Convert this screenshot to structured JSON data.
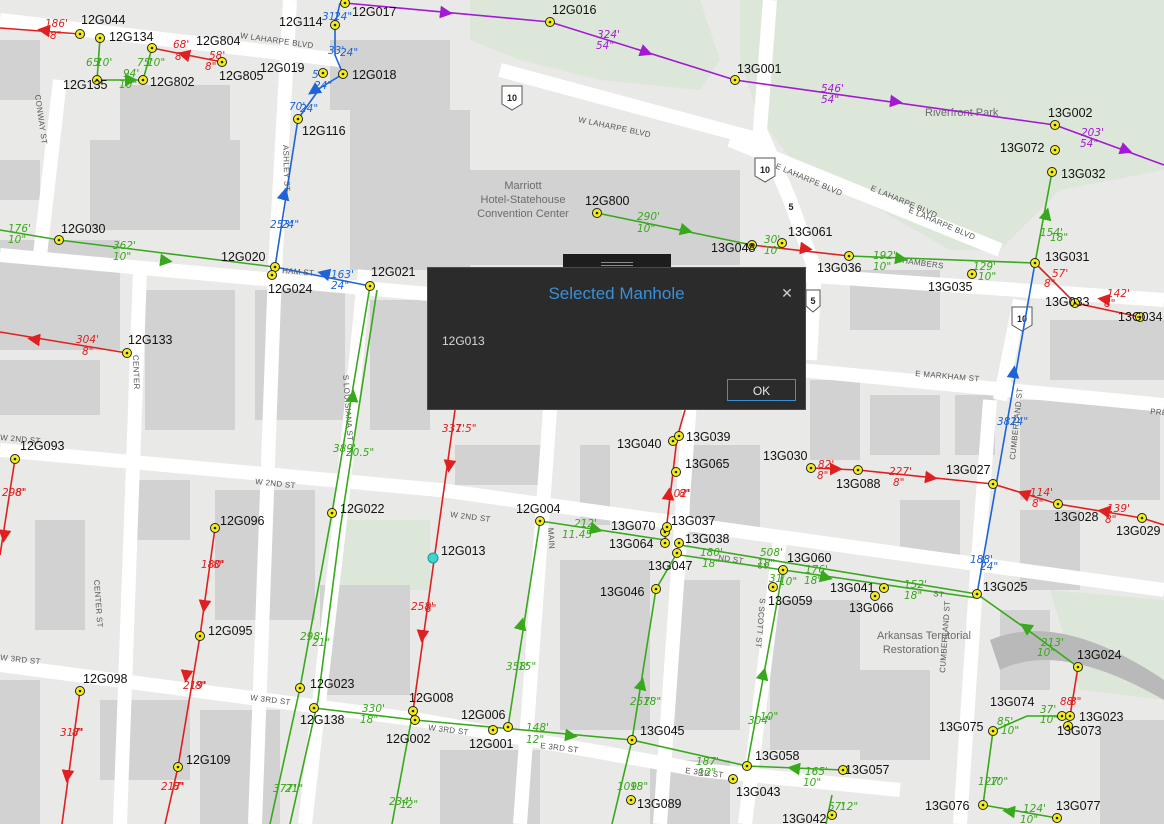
{
  "dialog": {
    "title": "Selected Manhole",
    "message": "12G013",
    "ok_label": "OK",
    "close_glyph": "✕"
  },
  "colors": {
    "gravity_pipe": "#e02020",
    "pipe_green": "#38a81c",
    "pipe_blue": "#1e64d8",
    "pipe_purple": "#a41ad4",
    "manhole_fill": "#f4ee16",
    "selected_fill": "#3fd4cf"
  },
  "map": {
    "streets": [
      "W LAHARPE BLVD",
      "W LAHARPE BLVD",
      "E LAHARPE BLVD",
      "E LAHARPE BLVD",
      "E LAHARPE BLVD",
      "CONWAY ST",
      "ASHLEY ST",
      "HAM ST",
      "CHAMBERS",
      "E MARKHAM ST",
      "PRE",
      "CENTER",
      "S LOUISIANA ST",
      "W 2ND ST",
      "W 2ND ST",
      "W 2ND ST",
      "MAIN",
      "CENTER ST",
      "W 3RD ST",
      "W 3RD ST",
      "W 3RD ST",
      "E 3RD ST",
      "E 3RD ST",
      "S SCOTT ST",
      "CUMBERLAND ST",
      "CUMBERLAND ST",
      "ND ST",
      "ST",
      "ST"
    ],
    "pois": [
      "Marriott",
      "Hotel-Statehouse",
      "Convention Center",
      "Riverfront Park",
      "Arkansas Territorial",
      "Restoration"
    ],
    "shields": [
      "10",
      "10",
      "5",
      "10",
      "5"
    ],
    "manholes": [
      "12G044",
      "12G134",
      "12G804",
      "12G805",
      "12G135",
      "12G802",
      "12G114",
      "12G017",
      "12G019",
      "12G018",
      "12G116",
      "12G016",
      "13G001",
      "13G002",
      "13G072",
      "13G032",
      "12G800",
      "12G030",
      "12G020",
      "12G024",
      "12G021",
      "13G048",
      "13G061",
      "13G036",
      "13G035",
      "13G031",
      "13G033",
      "13G034",
      "12G133",
      "12G093",
      "13G040",
      "13G039",
      "13G065",
      "13G030",
      "13G088",
      "13G027",
      "13G028",
      "13G029",
      "12G004",
      "12G022",
      "13G070",
      "13G037",
      "13G064",
      "13G038",
      "13G047",
      "13G060",
      "12G013",
      "12G096",
      "13G046",
      "13G041",
      "13G066",
      "13G025",
      "13G059",
      "12G095",
      "12G098",
      "12G023",
      "12G008",
      "12G138",
      "12G006",
      "12G002",
      "12G001",
      "13G045",
      "13G024",
      "13G074",
      "13G075",
      "13G023",
      "13G073",
      "12G109",
      "13G058",
      "13G057",
      "13G043",
      "13G089",
      "13G076",
      "13G077",
      "13G042"
    ],
    "pipe_labels": [
      "186'",
      "8\"",
      "68'",
      "8\"",
      "58'",
      "8\"",
      "65'",
      "10'",
      "75'",
      "10\"",
      "94'",
      "10\"",
      "31'",
      "24\"",
      "33'",
      "24\"",
      "54'",
      "24\"",
      "70'",
      "24\"",
      "324'",
      "54\"",
      "546'",
      "54\"",
      "203'",
      "54\"",
      "176'",
      "10\"",
      "362'",
      "10\"",
      "253'",
      "24\"",
      "163'",
      "24\"",
      "290'",
      "10\"",
      "30'",
      "10\"",
      "192'",
      "10\"",
      "129'",
      "10\"",
      "154'",
      "18\"",
      "57'",
      "8\"",
      "142'",
      "8\"",
      "304'",
      "8\"",
      "331'",
      "7.5\"",
      "389'",
      "20.5\"",
      "381'",
      "24\"",
      "102'",
      "8\"",
      "82'",
      "8\"",
      "227'",
      "8\"",
      "114'",
      "8\"",
      "139'",
      "8\"",
      "298'",
      "8\"",
      "212'",
      "11.45\"",
      "180'",
      "18\"",
      "508'",
      "18\"",
      "176'",
      "18\"",
      "152'",
      "18\"",
      "188'",
      "24\"",
      "31'",
      "10\"",
      "180'",
      "8\"",
      "258'",
      "8\"",
      "358'",
      "15\"",
      "298'",
      "21\"",
      "213'",
      "10\"",
      "219'",
      "8\"",
      "304'",
      "10\"",
      "257'",
      "18\"",
      "330'",
      "18\"",
      "148'",
      "12\"",
      "187'",
      "12\"",
      "85'",
      "10\"",
      "37'",
      "10\"",
      "88'",
      "8\"",
      "317'",
      "8\"",
      "217'",
      "8\"",
      "377'",
      "21\"",
      "234'",
      "12\"",
      "109'",
      "18\"",
      "165'",
      "10\"",
      "127'",
      "10\"",
      "57'",
      "12\"",
      "124'",
      "10\""
    ]
  }
}
